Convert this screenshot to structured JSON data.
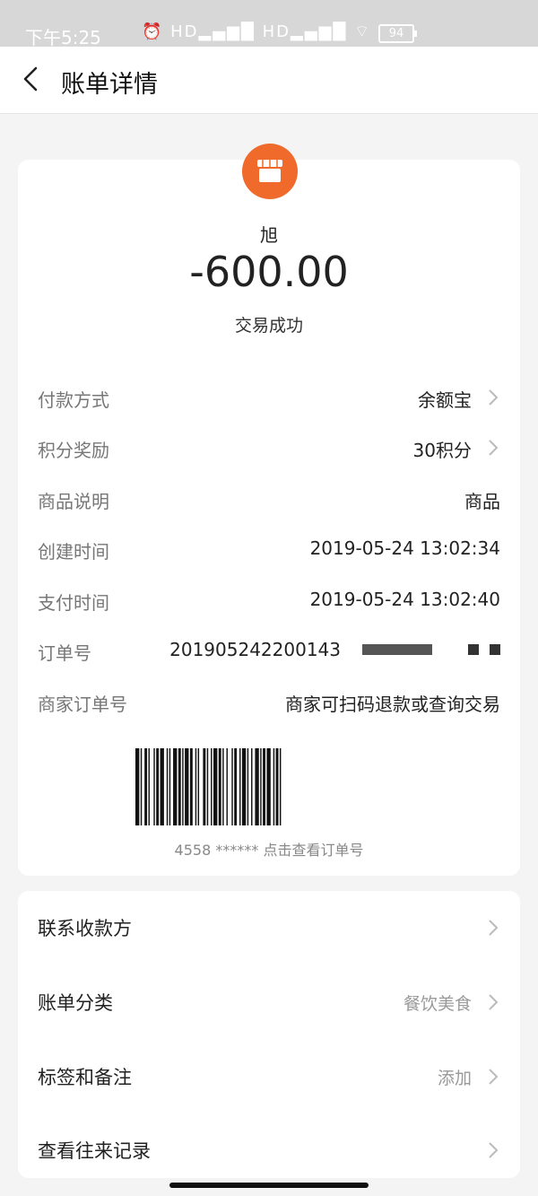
{
  "status_bar": {
    "time": "下午5:25",
    "signal_icons": "⏰ HD▂▄▆█ HD▂▄▆█ ⌔",
    "battery": "94"
  },
  "header": {
    "title": "账单详情"
  },
  "summary": {
    "merchant_name": "旭",
    "amount": "-600.00",
    "status": "交易成功",
    "logo_icon": "store-icon",
    "logo_color": "#f06a2b"
  },
  "details": [
    {
      "label": "付款方式",
      "value": "余额宝",
      "chevron": true
    },
    {
      "label": "积分奖励",
      "value": "30积分",
      "chevron": true
    },
    {
      "label": "商品说明",
      "value": "商品",
      "chevron": false
    },
    {
      "label": "创建时间",
      "value": "2019-05-24 13:02:34",
      "chevron": false
    },
    {
      "label": "支付时间",
      "value": "2019-05-24 13:02:40",
      "chevron": false
    },
    {
      "label": "订单号",
      "value": "201905242200143",
      "chevron": false
    },
    {
      "label": "商家订单号",
      "value": "商家可扫码退款或查询交易",
      "chevron": false
    }
  ],
  "barcode": {
    "caption": "4558 ****** 点击查看订单号"
  },
  "menu": [
    {
      "label": "联系收款方",
      "hint": ""
    },
    {
      "label": "账单分类",
      "hint": "餐饮美食"
    },
    {
      "label": "标签和备注",
      "hint": "添加"
    },
    {
      "label": "查看往来记录",
      "hint": ""
    }
  ]
}
